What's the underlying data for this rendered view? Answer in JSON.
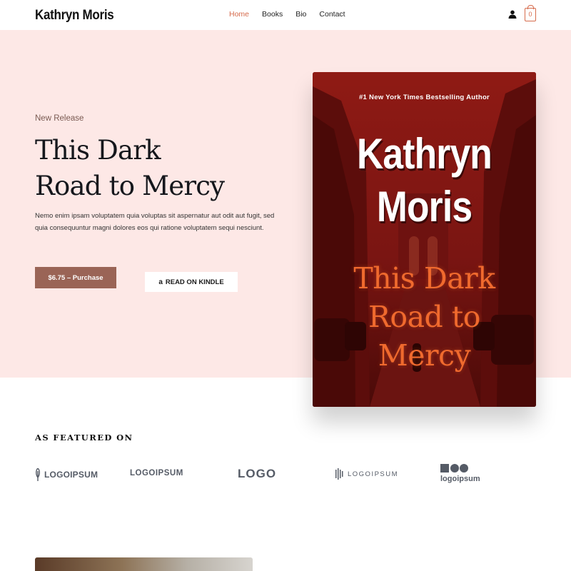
{
  "header": {
    "brand": "Kathryn Moris",
    "nav": [
      "Home",
      "Books",
      "Bio",
      "Contact"
    ],
    "active_nav": "Home",
    "cart_count": "0"
  },
  "hero": {
    "eyebrow": "New Release",
    "title_line1": "This Dark",
    "title_line2": "Road to Mercy",
    "description": "Nemo enim ipsam voluptatem quia voluptas sit aspernatur aut odit aut fugit, sed quia consequuntur magni dolores eos qui ratione voluptatem sequi nesciunt.",
    "purchase_label": "$6.75 – Purchase",
    "kindle_logo": "a",
    "kindle_label": "READ ON KINDLE"
  },
  "cover": {
    "tagline": "#1 New York Times Bestselling Author",
    "author_line1": "Kathryn",
    "author_line2": "Moris",
    "title_line1": "This Dark",
    "title_line2": "Road to",
    "title_line3": "Mercy"
  },
  "featured": {
    "label": "AS FEATURED ON",
    "logos": [
      "LOGOIPSUM",
      "LOGOIPSUM",
      "LOGO",
      "LOGOIPSUM",
      "logoipsum"
    ]
  },
  "colors": {
    "accent": "#d66b4c",
    "hero_bg": "#fde8e6",
    "button_bg": "#9a6456",
    "cover_red": "#7a1512"
  }
}
